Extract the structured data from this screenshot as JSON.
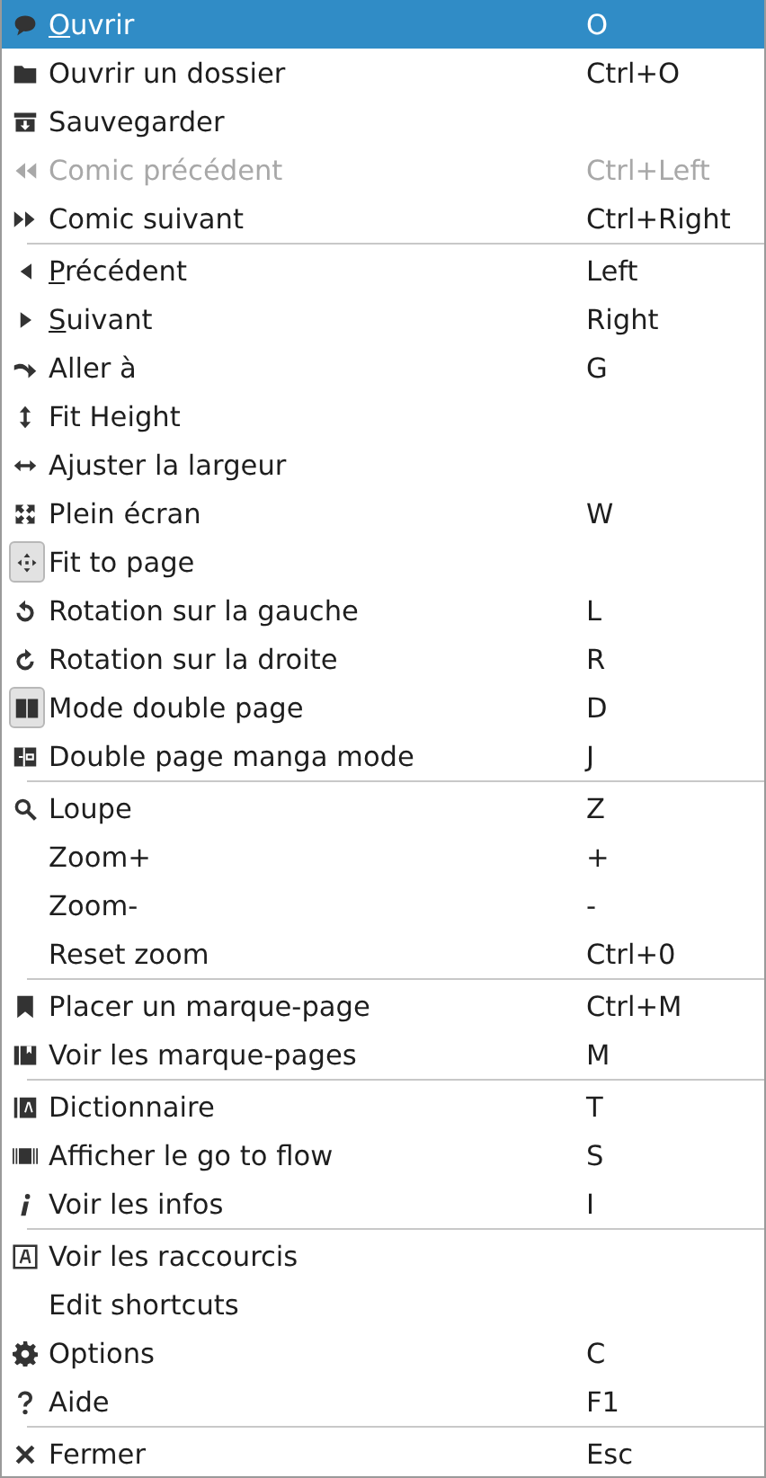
{
  "sections": [
    {
      "items": [
        {
          "label": "Ouvrir",
          "shortcut": "O",
          "mnemonic": true,
          "selected": true,
          "disabled": false,
          "checked": false
        },
        {
          "label": "Ouvrir un dossier",
          "shortcut": "Ctrl+O",
          "mnemonic": false,
          "selected": false,
          "disabled": false,
          "checked": false
        },
        {
          "label": "Sauvegarder",
          "mnemonic": false,
          "selected": false,
          "disabled": false,
          "checked": false
        },
        {
          "label": "Comic précédent",
          "shortcut": "Ctrl+Left",
          "mnemonic": false,
          "selected": false,
          "disabled": true,
          "checked": false
        },
        {
          "label": "Comic suivant",
          "shortcut": "Ctrl+Right",
          "mnemonic": false,
          "selected": false,
          "disabled": false,
          "checked": false
        }
      ]
    },
    {
      "items": [
        {
          "label": "Précédent",
          "shortcut": "Left",
          "mnemonic": true,
          "selected": false,
          "disabled": false,
          "checked": false
        },
        {
          "label": "Suivant",
          "shortcut": "Right",
          "mnemonic": true,
          "selected": false,
          "disabled": false,
          "checked": false
        },
        {
          "label": "Aller à",
          "shortcut": "G",
          "mnemonic": false,
          "selected": false,
          "disabled": false,
          "checked": false
        },
        {
          "label": "Fit Height",
          "mnemonic": false,
          "selected": false,
          "disabled": false,
          "checked": false
        },
        {
          "label": "Ajuster la largeur",
          "mnemonic": false,
          "selected": false,
          "disabled": false,
          "checked": false
        },
        {
          "label": "Plein écran",
          "shortcut": "W",
          "mnemonic": false,
          "selected": false,
          "disabled": false,
          "checked": false
        },
        {
          "label": "Fit to page",
          "mnemonic": false,
          "selected": false,
          "disabled": false,
          "checked": true
        },
        {
          "label": "Rotation sur la gauche",
          "shortcut": "L",
          "mnemonic": false,
          "selected": false,
          "disabled": false,
          "checked": false
        },
        {
          "label": "Rotation sur la droite",
          "shortcut": "R",
          "mnemonic": false,
          "selected": false,
          "disabled": false,
          "checked": false
        },
        {
          "label": "Mode double page",
          "shortcut": "D",
          "mnemonic": false,
          "selected": false,
          "disabled": false,
          "checked": true
        },
        {
          "label": "Double page manga mode",
          "shortcut": "J",
          "mnemonic": false,
          "selected": false,
          "disabled": false,
          "checked": false
        }
      ]
    },
    {
      "items": [
        {
          "label": "Loupe",
          "shortcut": "Z",
          "mnemonic": false,
          "selected": false,
          "disabled": false,
          "checked": false
        },
        {
          "label": "Zoom+",
          "shortcut": "+",
          "mnemonic": false,
          "selected": false,
          "disabled": false,
          "checked": false
        },
        {
          "label": "Zoom-",
          "shortcut": "-",
          "mnemonic": false,
          "selected": false,
          "disabled": false,
          "checked": false
        },
        {
          "label": "Reset zoom",
          "shortcut": "Ctrl+0",
          "mnemonic": false,
          "selected": false,
          "disabled": false,
          "checked": false
        }
      ]
    },
    {
      "items": [
        {
          "label": "Placer un marque-page",
          "shortcut": "Ctrl+M",
          "mnemonic": false,
          "selected": false,
          "disabled": false,
          "checked": false
        },
        {
          "label": "Voir les marque-pages",
          "shortcut": "M",
          "mnemonic": false,
          "selected": false,
          "disabled": false,
          "checked": false
        }
      ]
    },
    {
      "items": [
        {
          "label": "Dictionnaire",
          "shortcut": "T",
          "mnemonic": false,
          "selected": false,
          "disabled": false,
          "checked": false
        },
        {
          "label": "Afficher le go to flow",
          "shortcut": "S",
          "mnemonic": false,
          "selected": false,
          "disabled": false,
          "checked": false
        },
        {
          "label": "Voir les infos",
          "shortcut": "I",
          "mnemonic": false,
          "selected": false,
          "disabled": false,
          "checked": false
        }
      ]
    },
    {
      "items": [
        {
          "label": "Voir les raccourcis",
          "mnemonic": false,
          "selected": false,
          "disabled": false,
          "checked": false
        },
        {
          "label": "Edit shortcuts",
          "mnemonic": false,
          "selected": false,
          "disabled": false,
          "checked": false
        },
        {
          "label": "Options",
          "shortcut": "C",
          "mnemonic": false,
          "selected": false,
          "disabled": false,
          "checked": false
        },
        {
          "label": "Aide",
          "shortcut": "F1",
          "mnemonic": false,
          "selected": false,
          "disabled": false,
          "checked": false
        }
      ]
    },
    {
      "items": [
        {
          "label": "Fermer",
          "shortcut": "Esc",
          "mnemonic": false,
          "selected": false,
          "disabled": false,
          "checked": false
        }
      ]
    }
  ]
}
